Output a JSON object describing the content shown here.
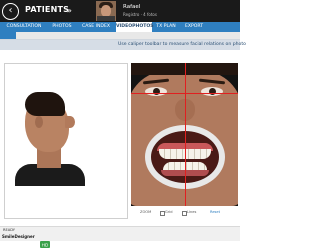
{
  "header": {
    "back_icon": "back-arrow-icon",
    "app_title": "PATIENTS",
    "chevron_glyph": "»",
    "patient_name": "Rafael",
    "patient_subtitle": "Registro · 4 fotos"
  },
  "tabs": [
    {
      "label": "CONSULTATION"
    },
    {
      "label": "PHOTOS"
    },
    {
      "label": "CASE INDEX"
    },
    {
      "label": "VIDEOPHOTOS"
    },
    {
      "label": "TX PLAN"
    },
    {
      "label": "EXPORT"
    }
  ],
  "active_tab_index": 3,
  "info_strip": {
    "text": "Use caliper toolbar to measure facial relations on photo"
  },
  "bottom_controls": [
    {
      "label": "ZOOM"
    },
    {
      "label": "Grid"
    },
    {
      "label": "Lines"
    },
    {
      "label": "Reset"
    }
  ],
  "status": {
    "caption": "READY",
    "brand": "SmileDesigner",
    "brand_suffix": "HD"
  },
  "colors": {
    "header_bg": "#1a1a1a",
    "tab_bar": "#2f7fc0",
    "info_strip": "#d6dde6",
    "guide_lines": "#e02020"
  }
}
